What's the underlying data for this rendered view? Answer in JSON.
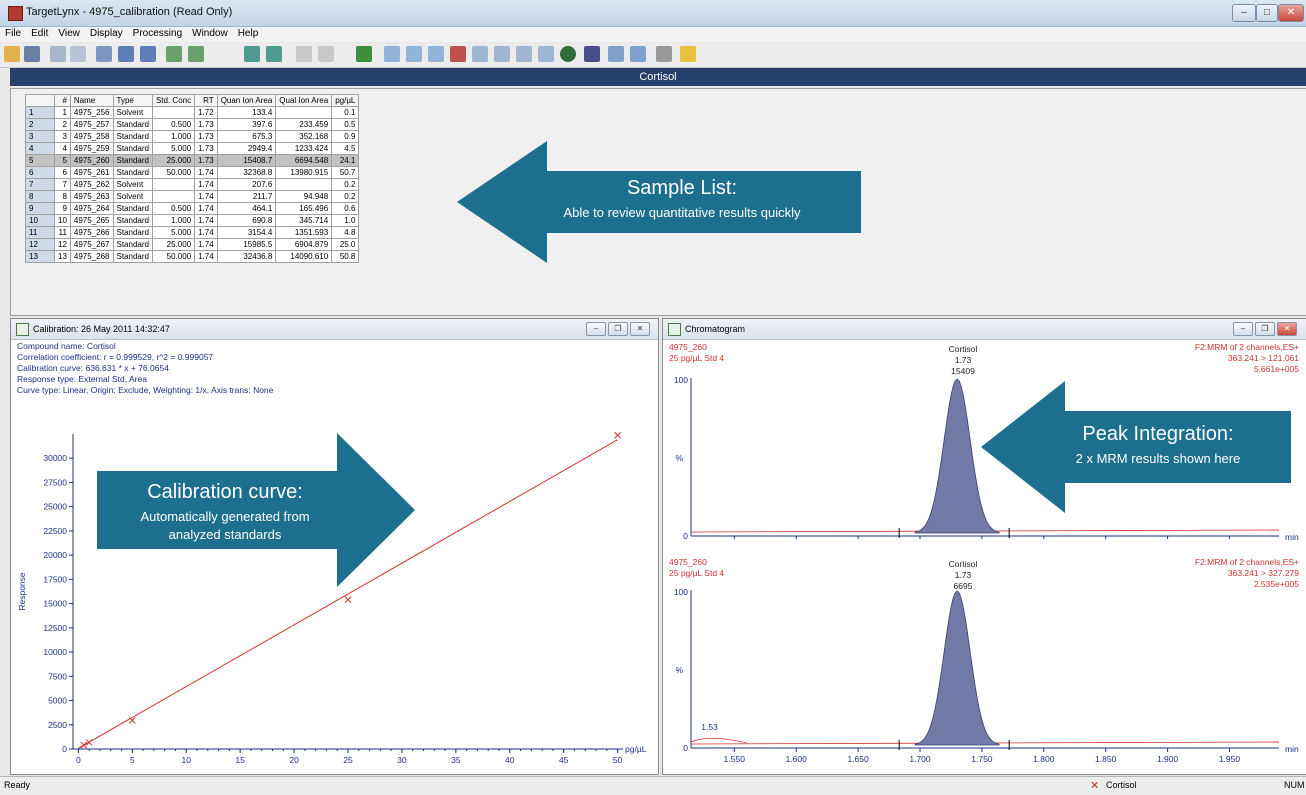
{
  "window": {
    "title": "TargetLynx - 4975_calibration (Read Only)"
  },
  "menu": [
    "File",
    "Edit",
    "View",
    "Display",
    "Processing",
    "Window",
    "Help"
  ],
  "compound_header": "Cortisol",
  "sample_table": {
    "headers": [
      "#",
      "Name",
      "Type",
      "Std. Conc",
      "RT",
      "Quan Ion Area",
      "Qual Ion Area",
      "pg/µL"
    ],
    "rows": [
      [
        "1",
        "4975_256",
        "Solvent",
        "",
        "1.72",
        "133.4",
        "",
        "0.1"
      ],
      [
        "2",
        "4975_257",
        "Standard",
        "0.500",
        "1.73",
        "397.6",
        "233.459",
        "0.5"
      ],
      [
        "3",
        "4975_258",
        "Standard",
        "1.000",
        "1.73",
        "675.3",
        "352.168",
        "0.9"
      ],
      [
        "4",
        "4975_259",
        "Standard",
        "5.000",
        "1.73",
        "2949.4",
        "1233.424",
        "4.5"
      ],
      [
        "5",
        "4975_260",
        "Standard",
        "25.000",
        "1.73",
        "15408.7",
        "6694.548",
        "24.1"
      ],
      [
        "6",
        "4975_261",
        "Standard",
        "50.000",
        "1.74",
        "32368.8",
        "13980.915",
        "50.7"
      ],
      [
        "7",
        "4975_262",
        "Solvent",
        "",
        "1.74",
        "207.6",
        "",
        "0.2"
      ],
      [
        "8",
        "4975_263",
        "Solvent",
        "",
        "1.74",
        "211.7",
        "94.948",
        "0.2"
      ],
      [
        "9",
        "4975_264",
        "Standard",
        "0.500",
        "1.74",
        "464.1",
        "165.496",
        "0.6"
      ],
      [
        "10",
        "4975_265",
        "Standard",
        "1.000",
        "1.74",
        "690.8",
        "345.714",
        "1.0"
      ],
      [
        "11",
        "4975_266",
        "Standard",
        "5.000",
        "1.74",
        "3154.4",
        "1351.593",
        "4.8"
      ],
      [
        "12",
        "4975_267",
        "Standard",
        "25.000",
        "1.74",
        "15985.5",
        "6904.879",
        "25.0"
      ],
      [
        "13",
        "4975_268",
        "Standard",
        "50.000",
        "1.74",
        "32436.8",
        "14090.610",
        "50.8"
      ]
    ],
    "selected_row": 4
  },
  "callouts": {
    "sample_list": {
      "title": "Sample List:",
      "subtitle": "Able to review quantitative results quickly"
    },
    "calibration": {
      "title": "Calibration curve:",
      "line1": "Automatically generated from",
      "line2": "analyzed standards"
    },
    "peak": {
      "title": "Peak Integration:",
      "subtitle": "2 x MRM results shown here"
    }
  },
  "calibration_window": {
    "title": "Calibration: 26 May 2011 14:32:47",
    "info": [
      "Compound name: Cortisol",
      "Correlation coefficient: r = 0.999529, r^2 = 0.999057",
      "Calibration curve: 636.631 * x + 76.0654",
      "Response type: External Std, Area",
      "Curve type: Linear, Origin: Exclude, Weighting: 1/x, Axis trans: None"
    ],
    "ylabel": "Response",
    "xunit": "pg/µL"
  },
  "chromatogram_window": {
    "title": "Chromatogram",
    "panels": [
      {
        "left1": "4975_260",
        "left2": "25 pg/µL Std 4",
        "center1": "Cortisol",
        "center2": "1.73",
        "center3": "15409",
        "right1": "F2:MRM of 2 channels,ES+",
        "right2": "363.241 > 121.061",
        "right3": "5.661e+005",
        "y100": "100",
        "ypct": "%",
        "y0": "0",
        "xunit": "min"
      },
      {
        "left1": "4975_260",
        "left2": "25 pg/µL Std 4",
        "center1": "Cortisol",
        "center2": "1.73",
        "center3": "6695",
        "right1": "F2:MRM of 2 channels,ES+",
        "right2": "363.241 > 327.279",
        "right3": "2.535e+005",
        "y100": "100",
        "ypct": "%",
        "y0": "0",
        "xunit": "min",
        "side_peak": "1.53"
      }
    ],
    "xticks": [
      "1.550",
      "1.600",
      "1.650",
      "1.700",
      "1.750",
      "1.800",
      "1.850",
      "1.900",
      "1.950"
    ]
  },
  "chart_data": [
    {
      "type": "scatter",
      "title": "",
      "xlabel": "pg/µL",
      "ylabel": "Response",
      "xlim": [
        -0.5,
        50.5
      ],
      "ylim": [
        0,
        32500
      ],
      "xticks": [
        0.0,
        5.0,
        10.0,
        15.0,
        20.0,
        25.0,
        30.0,
        35.0,
        40.0,
        45.0,
        50.0
      ],
      "yticks": [
        0,
        2500,
        5000,
        7500,
        10000,
        12500,
        15000,
        17500,
        20000,
        22500,
        25000,
        27500,
        30000
      ],
      "points": [
        [
          0.5,
          397.6
        ],
        [
          1.0,
          675.3
        ],
        [
          5.0,
          2949.4
        ],
        [
          25.0,
          15408.7
        ],
        [
          50.0,
          32368.8
        ]
      ],
      "fit_line": {
        "slope": 636.631,
        "intercept": 76.0654
      },
      "color": "#d0312d"
    }
  ],
  "status": {
    "left": "Ready",
    "compound": "Cortisol",
    "right": "NUM"
  },
  "colors": {
    "header_bg": "#24406b",
    "callout": "#1d6f8f",
    "peak_fill": "#737aa8",
    "trace": "#d0312d",
    "axis": "#1e2f8a"
  }
}
